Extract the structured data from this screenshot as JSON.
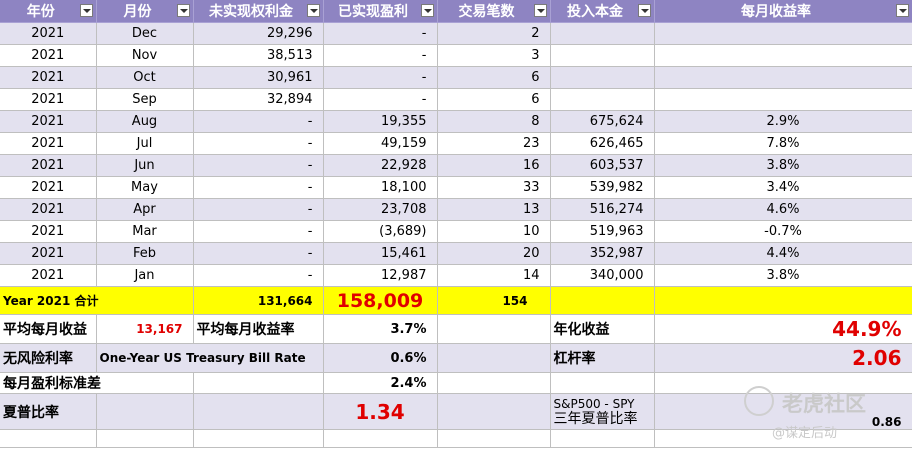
{
  "headers": [
    "年份",
    "月份",
    "未实现权利金",
    "已实现盈利",
    "交易笔数",
    "投入本金",
    "每月收益率"
  ],
  "rows": [
    [
      "2021",
      "Dec",
      "29,296",
      "-",
      "2",
      "",
      ""
    ],
    [
      "2021",
      "Nov",
      "38,513",
      "-",
      "3",
      "",
      ""
    ],
    [
      "2021",
      "Oct",
      "30,961",
      "-",
      "6",
      "",
      ""
    ],
    [
      "2021",
      "Sep",
      "32,894",
      "-",
      "6",
      "",
      ""
    ],
    [
      "2021",
      "Aug",
      "-",
      "19,355",
      "8",
      "675,624",
      "2.9%"
    ],
    [
      "2021",
      "Jul",
      "-",
      "49,159",
      "23",
      "626,465",
      "7.8%"
    ],
    [
      "2021",
      "Jun",
      "-",
      "22,928",
      "16",
      "603,537",
      "3.8%"
    ],
    [
      "2021",
      "May",
      "-",
      "18,100",
      "33",
      "539,982",
      "3.4%"
    ],
    [
      "2021",
      "Apr",
      "-",
      "23,708",
      "13",
      "516,274",
      "4.6%"
    ],
    [
      "2021",
      "Mar",
      "-",
      "(3,689)",
      "10",
      "519,963",
      "-0.7%"
    ],
    [
      "2021",
      "Feb",
      "-",
      "15,461",
      "20",
      "352,987",
      "4.4%"
    ],
    [
      "2021",
      "Jan",
      "-",
      "12,987",
      "14",
      "340,000",
      "3.8%"
    ]
  ],
  "total": {
    "label": "Year 2021 合计",
    "unrealized": "131,664",
    "realized": "158,009",
    "trades": "154"
  },
  "stats": {
    "avg_monthly_profit_label": "平均每月收益",
    "avg_monthly_profit": "13,167",
    "avg_monthly_return_label": "平均每月收益率",
    "avg_monthly_return": "3.7%",
    "annualized_label": "年化收益",
    "annualized": "44.9%",
    "risk_free_label": "无风险利率",
    "risk_free_desc": "One-Year US Treasury Bill Rate",
    "risk_free": "0.6%",
    "leverage_label": "杠杆率",
    "leverage": "2.06",
    "stdev_label": "每月盈利标准差",
    "stdev": "2.4%",
    "sharpe_label": "夏普比率",
    "sharpe": "1.34",
    "spy_label": "S&P500 - SPY",
    "spy_sharpe_label": "三年夏普比率",
    "spy_sharpe": "0.86"
  },
  "watermark": {
    "brand": "老虎社区",
    "handle": "@谋定后动"
  }
}
